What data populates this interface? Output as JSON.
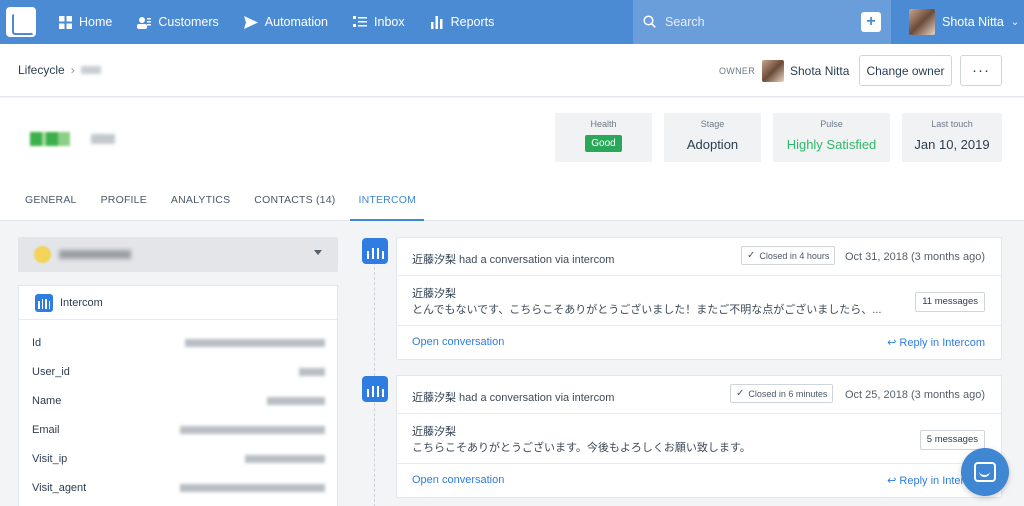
{
  "nav": {
    "items": [
      {
        "label": "Home",
        "icon": "grid-icon"
      },
      {
        "label": "Customers",
        "icon": "customers-icon"
      },
      {
        "label": "Automation",
        "icon": "send-icon"
      },
      {
        "label": "Inbox",
        "icon": "inbox-icon"
      },
      {
        "label": "Reports",
        "icon": "bar-chart-icon"
      }
    ],
    "search_placeholder": "Search",
    "user_name": "Shota Nitta",
    "accent": "#4a8bd4"
  },
  "header": {
    "breadcrumb_root": "Lifecycle",
    "owner_label": "OWNER",
    "owner_name": "Shota Nitta",
    "change_owner": "Change owner",
    "more": "···"
  },
  "stats": {
    "health": {
      "title": "Health",
      "value": "Good"
    },
    "stage": {
      "title": "Stage",
      "value": "Adoption"
    },
    "pulse": {
      "title": "Pulse",
      "value": "Highly Satisfied"
    },
    "last_touch": {
      "title": "Last touch",
      "value": "Jan 10, 2019"
    }
  },
  "tabs": [
    "GENERAL",
    "PROFILE",
    "ANALYTICS",
    "CONTACTS (14)",
    "INTERCOM"
  ],
  "left_card": {
    "title": "Intercom",
    "fields": [
      "Id",
      "User_id",
      "Name",
      "Email",
      "Visit_ip",
      "Visit_agent"
    ]
  },
  "conversations": [
    {
      "name": "近藤汐梨",
      "action": " had a conversation via intercom",
      "closed": "Closed in 4 hours",
      "date": "Oct 31, 2018 (3 months ago)",
      "author": "近藤汐梨",
      "message": "とんでもないです、こちらこそありがとうございました！またご不明な点がございましたら、...",
      "count": "11 messages",
      "open": "Open conversation",
      "reply": "Reply in Intercom"
    },
    {
      "name": "近藤汐梨",
      "action": " had a conversation via intercom",
      "closed": "Closed in 6 minutes",
      "date": "Oct 25, 2018 (3 months ago)",
      "author": "近藤汐梨",
      "message": "こちらこそありがとうございます。今後もよろしくお願い致します。",
      "count": "5 messages",
      "open": "Open conversation",
      "reply": "Reply in Intercom"
    }
  ]
}
